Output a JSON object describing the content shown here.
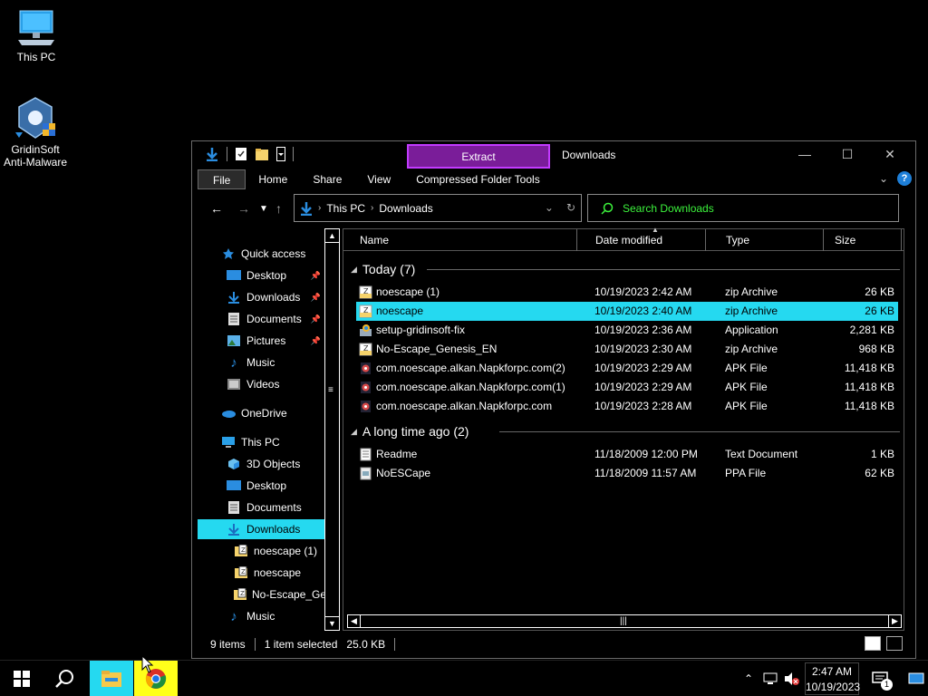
{
  "desktop": {
    "icons": [
      {
        "label": "This PC"
      },
      {
        "label_line1": "GridinSoft",
        "label_line2": "Anti-Malware"
      }
    ]
  },
  "window": {
    "contextual_tab": "Extract",
    "title": "Downloads",
    "ribbon_tabs": [
      "File",
      "Home",
      "Share",
      "View",
      "Compressed Folder Tools"
    ],
    "address": {
      "segments": [
        "This PC",
        "Downloads"
      ]
    },
    "search_placeholder": "Search Downloads"
  },
  "nav_pane": [
    {
      "label": "Quick access",
      "icon": "star-icon"
    },
    {
      "label": "Desktop",
      "icon": "desktop-icon",
      "pinned": true
    },
    {
      "label": "Downloads",
      "icon": "download-arrow-icon",
      "pinned": true
    },
    {
      "label": "Documents",
      "icon": "document-icon",
      "pinned": true
    },
    {
      "label": "Pictures",
      "icon": "picture-icon",
      "pinned": true
    },
    {
      "label": "Music",
      "icon": "music-icon"
    },
    {
      "label": "Videos",
      "icon": "video-icon"
    },
    {
      "label": "OneDrive",
      "icon": "cloud-icon"
    },
    {
      "label": "This PC",
      "icon": "computer-icon"
    },
    {
      "label": "3D Objects",
      "icon": "cube-icon"
    },
    {
      "label": "Desktop",
      "icon": "desktop-icon"
    },
    {
      "label": "Documents",
      "icon": "document-icon"
    },
    {
      "label": "Downloads",
      "icon": "download-arrow-icon",
      "selected": true
    },
    {
      "label": "noescape (1)",
      "icon": "zip-icon"
    },
    {
      "label": "noescape",
      "icon": "zip-icon"
    },
    {
      "label": "No-Escape_Gen",
      "icon": "zip-icon"
    },
    {
      "label": "Music",
      "icon": "music-icon"
    }
  ],
  "columns": [
    "Name",
    "Date modified",
    "Type",
    "Size"
  ],
  "groups": [
    {
      "label": "Today (7)",
      "files": [
        {
          "name": "noescape (1)",
          "date": "10/19/2023 2:42 AM",
          "type": "zip Archive",
          "size": "26 KB",
          "icon": "zip-icon"
        },
        {
          "name": "noescape",
          "date": "10/19/2023 2:40 AM",
          "type": "zip Archive",
          "size": "26 KB",
          "icon": "zip-icon",
          "selected": true
        },
        {
          "name": "setup-gridinsoft-fix",
          "date": "10/19/2023 2:36 AM",
          "type": "Application",
          "size": "2,281 KB",
          "icon": "installer-icon"
        },
        {
          "name": "No-Escape_Genesis_EN",
          "date": "10/19/2023 2:30 AM",
          "type": "zip Archive",
          "size": "968 KB",
          "icon": "zip-icon"
        },
        {
          "name": "com.noescape.alkan.Napkforpc.com(2)",
          "date": "10/19/2023 2:29 AM",
          "type": "APK File",
          "size": "11,418 KB",
          "icon": "apk-icon"
        },
        {
          "name": "com.noescape.alkan.Napkforpc.com(1)",
          "date": "10/19/2023 2:29 AM",
          "type": "APK File",
          "size": "11,418 KB",
          "icon": "apk-icon"
        },
        {
          "name": "com.noescape.alkan.Napkforpc.com",
          "date": "10/19/2023 2:28 AM",
          "type": "APK File",
          "size": "11,418 KB",
          "icon": "apk-icon"
        }
      ]
    },
    {
      "label": "A long time ago (2)",
      "files": [
        {
          "name": "Readme",
          "date": "11/18/2009 12:00 PM",
          "type": "Text Document",
          "size": "1 KB",
          "icon": "text-file-icon"
        },
        {
          "name": "NoESCape",
          "date": "11/18/2009 11:57 AM",
          "type": "PPA File",
          "size": "62 KB",
          "icon": "generic-file-icon"
        }
      ]
    }
  ],
  "status": {
    "items": "9 items",
    "selected": "1 item selected",
    "size": "25.0 KB"
  },
  "taskbar": {
    "time": "2:47 AM",
    "date": "10/19/2023",
    "notifications": "1"
  }
}
